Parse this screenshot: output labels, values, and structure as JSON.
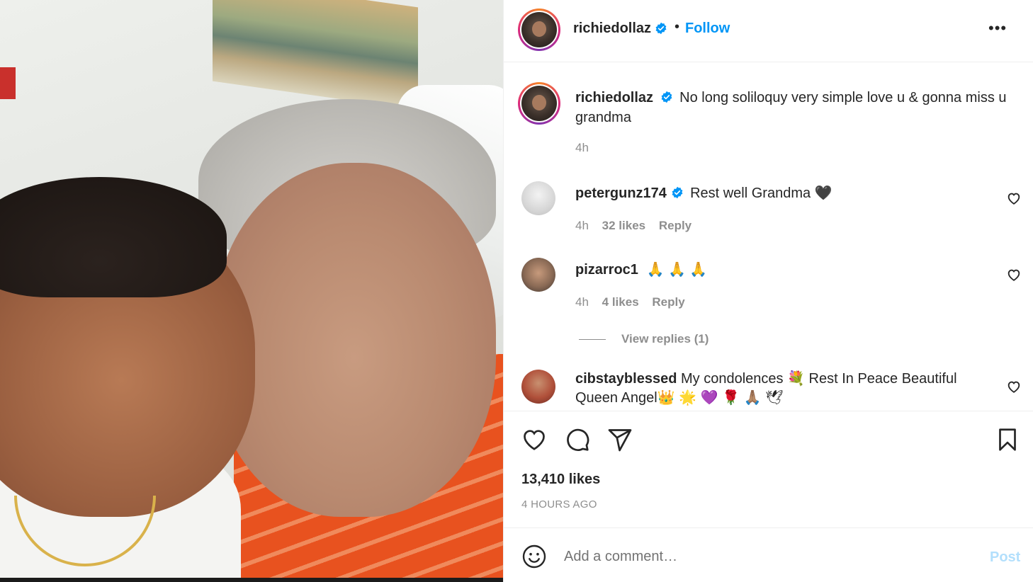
{
  "post": {
    "image_alt": "Selfie of a man kissing his grandmother's cheek",
    "author": {
      "username": "richiedollaz",
      "verified": true
    },
    "follow_label": "Follow",
    "separator": "•",
    "more_label": "•••",
    "caption": {
      "username": "richiedollaz",
      "text": "No long soliloquy very simple love u & gonna miss u grandma",
      "time": "4h"
    },
    "comments": [
      {
        "username": "petergunz174",
        "verified": true,
        "text": "Rest well Grandma 🖤",
        "time": "4h",
        "likes": "32 likes",
        "reply_label": "Reply"
      },
      {
        "username": "pizarroc1",
        "verified": false,
        "text": "🙏 🙏 🙏",
        "time": "4h",
        "likes": "4 likes",
        "reply_label": "Reply"
      },
      {
        "username": "cibstayblessed",
        "verified": false,
        "text": "My condolences 💐 Rest In Peace Beautiful Queen Angel👑 🌟 💜 🌹 🙏🏽 🕊"
      }
    ],
    "view_replies_label": "View replies (1)",
    "likes_count": "13,410 likes",
    "posted_ago": "4 HOURS AGO",
    "add_comment": {
      "placeholder": "Add a comment…",
      "post_label": "Post"
    }
  },
  "colors": {
    "accent": "#0095f6",
    "post_disabled": "#b2dffc",
    "muted": "#8e8e8e",
    "text": "#262626"
  },
  "icons": [
    "verified-badge-icon",
    "more-options-icon",
    "heart-icon",
    "comment-icon",
    "share-icon",
    "bookmark-icon",
    "emoji-icon"
  ]
}
